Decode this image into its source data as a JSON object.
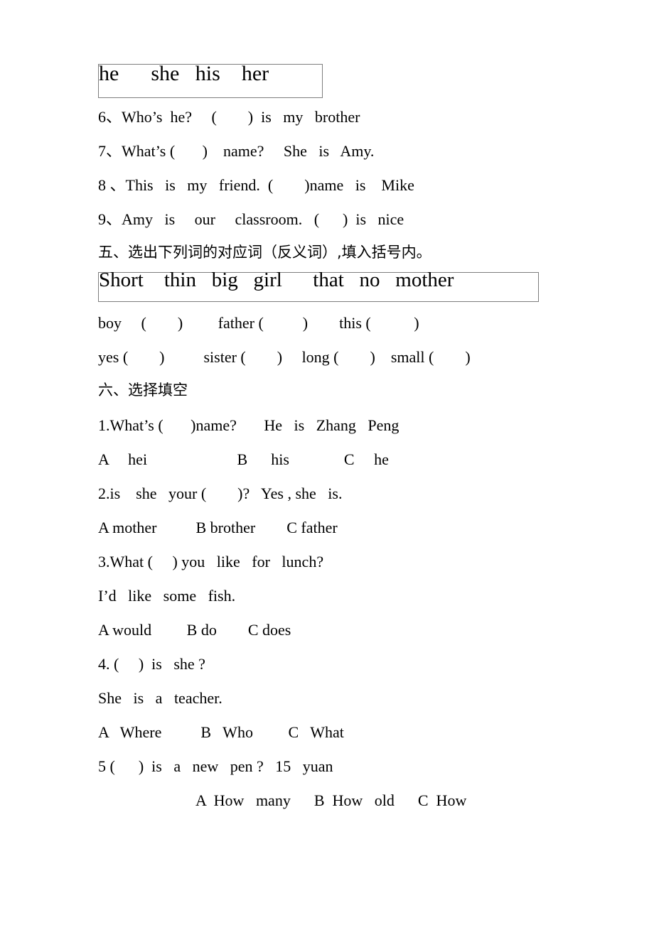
{
  "document": {
    "type": "english-exam-worksheet-page",
    "page_background": "#ffffff",
    "text_color": "#000000",
    "box_border_color": "#7d7d7d"
  },
  "word_bank_pronouns": {
    "name": "pronoun-word-bank",
    "words": "he      she   his    her"
  },
  "fill_in_questions": [
    {
      "number": "6",
      "text": "6、Who’s  he?     (        )  is   my   brother"
    },
    {
      "number": "7",
      "text": "7、What’s (       )    name?     She   is   Amy."
    },
    {
      "number": "8",
      "text": "8 、This   is   my   friend.  (        )name   is    Mike"
    },
    {
      "number": "9",
      "text": "9、Amy   is     our     classroom.   (      )  is   nice"
    }
  ],
  "section_five": {
    "heading": "五、选出下列词的对应词（反义词）,填入括号内。",
    "word_bank": {
      "name": "opposites-word-bank",
      "words": "Short    thin   big   girl      that   no   mother"
    },
    "answer_rows": [
      "boy     (        )         father (          )        this (           )",
      "yes (        )          sister (        )     long (        )    small (        )"
    ]
  },
  "section_six": {
    "heading": "六、选择填空",
    "questions": [
      {
        "stem": "1.What’s (       )name?       He   is   Zhang   Peng",
        "choices": "A     hei                       B      his              C     he"
      },
      {
        "stem": "2.is    she   your (        )?   Yes , she   is.",
        "choices": "A mother          B brother        C father"
      },
      {
        "stem": "3.What (     ) you   like   for   lunch?",
        "stem_line2": "I’d   like   some   fish.",
        "choices": "A would         B do        C does"
      },
      {
        "stem": "4. (     )  is   she ?",
        "stem_line2": "She   is   a   teacher.",
        "choices": "A   Where          B   Who         C   What"
      },
      {
        "stem": "5 (      )  is   a   new   pen ?   15   yuan",
        "choices": "A  How   many      B  How   old      C  How"
      }
    ]
  }
}
